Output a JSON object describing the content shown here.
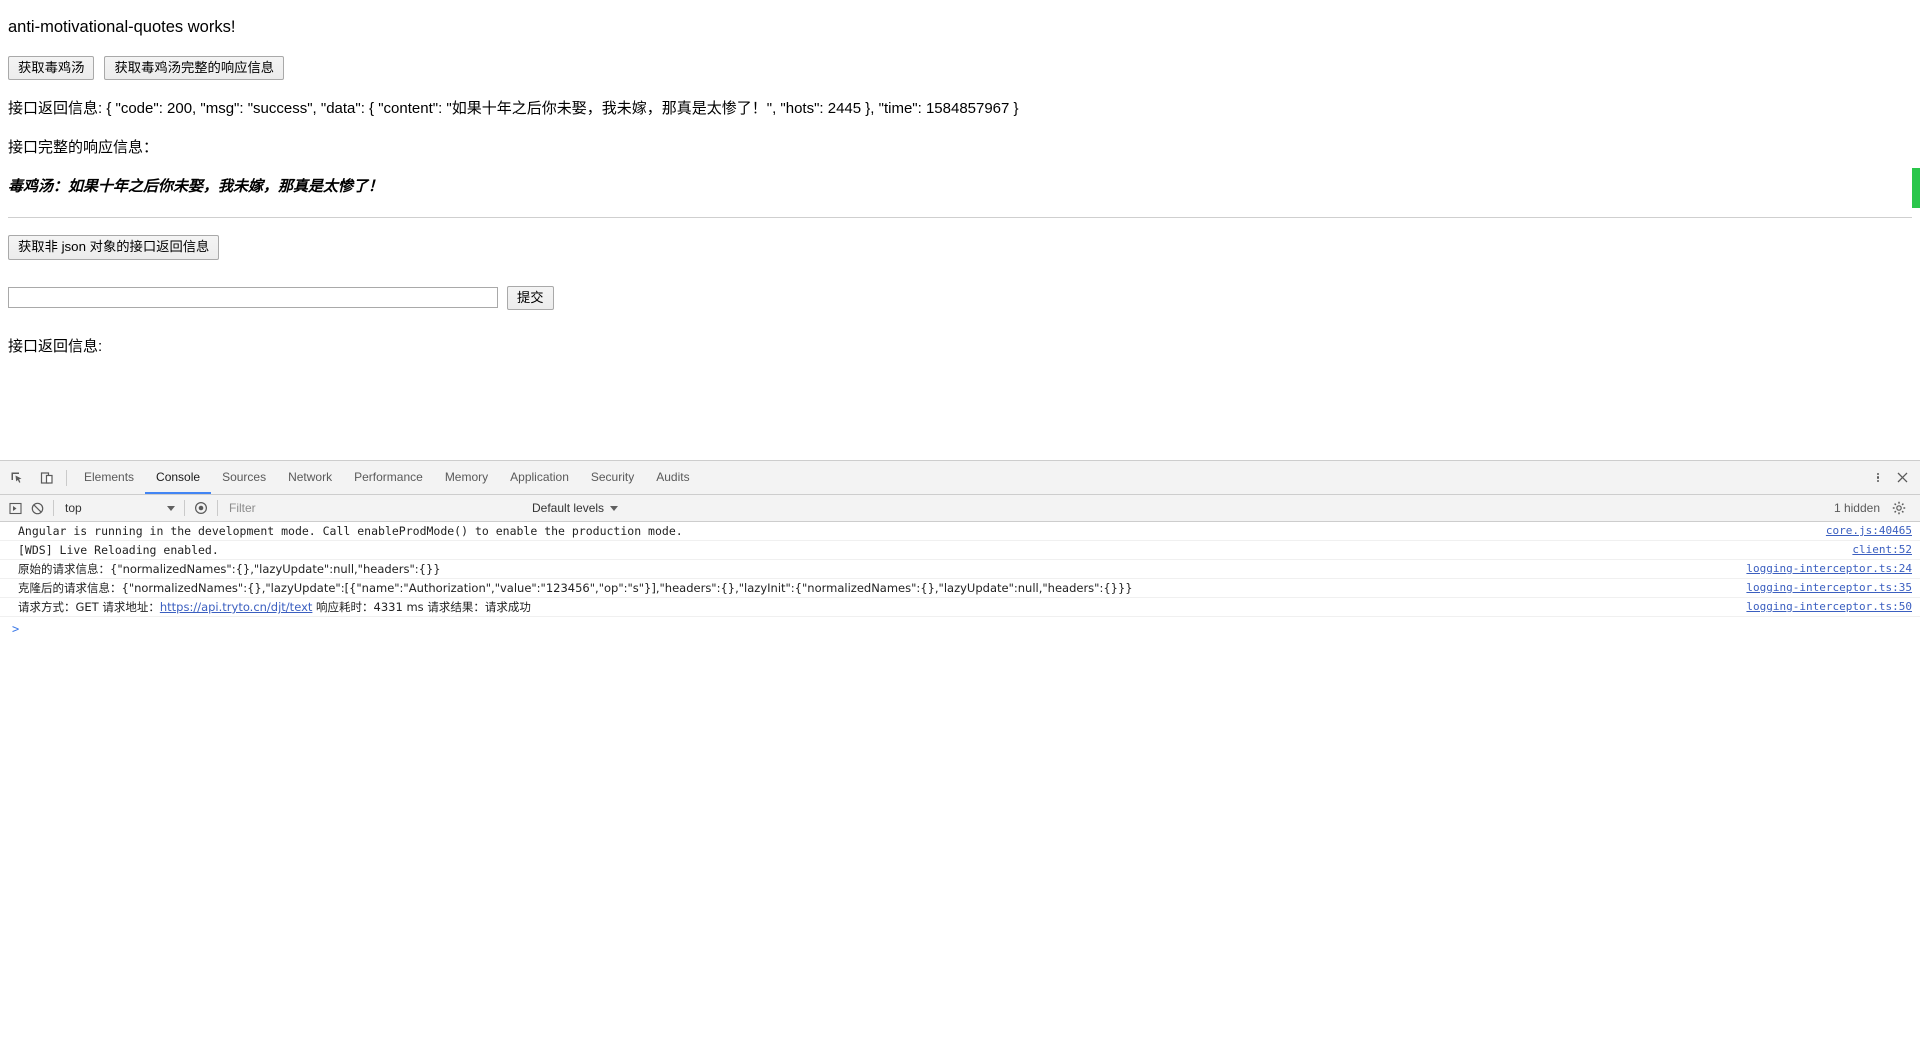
{
  "page": {
    "title": "anti-motivational-quotes works!",
    "buttons": {
      "get_quote": "获取毒鸡汤",
      "get_full_response": "获取毒鸡汤完整的响应信息",
      "get_non_json": "获取非 json 对象的接口返回信息",
      "submit": "提交"
    },
    "response_label_1": "接口返回信息: { \"code\": 200, \"msg\": \"success\", \"data\": { \"content\": \"如果十年之后你未娶，我未嫁，那真是太惨了！\", \"hots\": 2445 }, \"time\": 1584857967 }",
    "full_response_label": "接口完整的响应信息：",
    "quote_text": "毒鸡汤：如果十年之后你未娶，我未嫁，那真是太惨了！",
    "input_value": "",
    "input_placeholder": "",
    "tail_label": "接口返回信息:",
    "scroll_marker_color": "#2ac64b"
  },
  "devtools": {
    "icons": {
      "inspect": "inspect-element-icon",
      "device": "device-toolbar-icon",
      "menu": "more-options-icon",
      "close": "close-icon",
      "execute": "execute-snippet-icon",
      "clear": "clear-console-icon",
      "eye": "live-expression-icon",
      "settings": "settings-gear-icon"
    },
    "tabs": [
      {
        "label": "Elements",
        "active": false
      },
      {
        "label": "Console",
        "active": true
      },
      {
        "label": "Sources",
        "active": false
      },
      {
        "label": "Network",
        "active": false
      },
      {
        "label": "Performance",
        "active": false
      },
      {
        "label": "Memory",
        "active": false
      },
      {
        "label": "Application",
        "active": false
      },
      {
        "label": "Security",
        "active": false
      },
      {
        "label": "Audits",
        "active": false
      }
    ],
    "filterbar": {
      "context": "top",
      "filter_placeholder": "Filter",
      "filter_value": "",
      "levels": "Default levels",
      "hidden_count": "1 hidden"
    },
    "messages": [
      {
        "text": "Angular is running in the development mode. Call enableProdMode() to enable the production mode.",
        "source": "core.js:40465",
        "type": "plain"
      },
      {
        "text": "[WDS] Live Reloading enabled.",
        "source": "client:52",
        "type": "plain"
      },
      {
        "text": "原始的请求信息：{\"normalizedNames\":{},\"lazyUpdate\":null,\"headers\":{}}",
        "source": "logging-interceptor.ts:24",
        "type": "plain"
      },
      {
        "text": "克隆后的请求信息：{\"normalizedNames\":{},\"lazyUpdate\":[{\"name\":\"Authorization\",\"value\":\"123456\",\"op\":\"s\"}],\"headers\":{},\"lazyInit\":{\"normalizedNames\":{},\"lazyUpdate\":null,\"headers\":{}}}",
        "source": "logging-interceptor.ts:35",
        "type": "plain"
      },
      {
        "text_before_link": "请求方式：GET 请求地址：",
        "link": "https://api.tryto.cn/djt/text",
        "text_after_link": " 响应耗时：4331 ms 请求结果：请求成功",
        "source": "logging-interceptor.ts:50",
        "type": "link"
      }
    ],
    "prompt_symbol": ">"
  }
}
